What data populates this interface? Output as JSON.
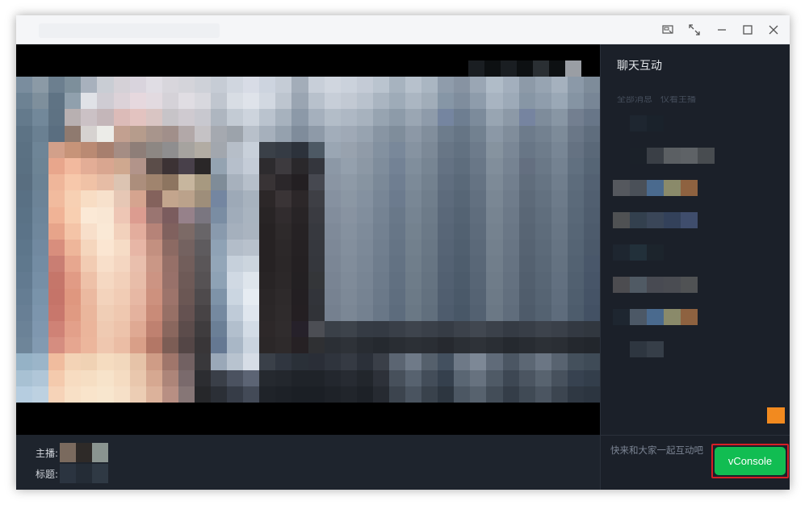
{
  "window": {
    "controls": [
      {
        "name": "pin-window-icon"
      },
      {
        "name": "expand-icon"
      },
      {
        "name": "minimize-icon"
      },
      {
        "name": "maximize-icon"
      },
      {
        "name": "close-icon"
      }
    ]
  },
  "video": {
    "description_state": "pixelated",
    "top_strip_colors": [
      "#1a1e22",
      "#0d1012",
      "#1a1e22",
      "#0d1012",
      "#2a2f33",
      "#0d1012",
      "#9a9ea4"
    ],
    "pixel_colors": [
      "#7a8d9e",
      "#8b9aa6",
      "#6c7f8f",
      "#7d8f9b",
      "#a8b1bd",
      "#c9cdd4",
      "#d5d1d7",
      "#d9d4dd",
      "#e0dde4",
      "#d8d6dc",
      "#d4d4da",
      "#ced1d8",
      "#c6ccd5",
      "#d0d6df",
      "#d8dce6",
      "#cdd4df",
      "#c5ccd6",
      "#a3adb9",
      "#c8cfd9",
      "#d0d6df",
      "#cbd2dc",
      "#c4cbd6",
      "#bac4cf",
      "#a7b3bf",
      "#b7c1cc",
      "#aab6c2",
      "#8f9cab",
      "#8793a2",
      "#9aa6b4",
      "#b0bcc8",
      "#a3afbd",
      "#8d9aa8",
      "#97a4b2",
      "#a5b1be",
      "#8b99a8",
      "#7e8c9a",
      "#6d8293",
      "#7e8f9c",
      "#5f7384",
      "#90a0ad",
      "#e0e2e7",
      "#cfccd3",
      "#dcd2d8",
      "#e6d8de",
      "#e2dae0",
      "#d5d2d8",
      "#e0dde3",
      "#d8d8de",
      "#c0c6cf",
      "#d8dde4",
      "#dfe3ea",
      "#d2d8e1",
      "#bdc5cf",
      "#9aa5b2",
      "#b8c1cc",
      "#c7ced8",
      "#c2c9d3",
      "#b9c2cd",
      "#aab5c1",
      "#9eabb8",
      "#abb6c2",
      "#a1adb9",
      "#8696a6",
      "#7f8d9d",
      "#8e9cab",
      "#a8b4c1",
      "#9daab8",
      "#8796a5",
      "#8f9dac",
      "#9aa8b6",
      "#8594a3",
      "#788696",
      "#647a8c",
      "#72889a",
      "#5e7283",
      "#b8b0b1",
      "#cbc1c5",
      "#c4b6b9",
      "#dcbbb8",
      "#e3c3c0",
      "#d9c5c3",
      "#c7c4c8",
      "#cfcad0",
      "#c8c8cf",
      "#aeb6c0",
      "#c3cbd4",
      "#cdd4dd",
      "#bac3ce",
      "#a7b2be",
      "#8c99a8",
      "#a5b0bd",
      "#b3bdc8",
      "#aeb8c4",
      "#a7b2be",
      "#97a4b1",
      "#8d9ba9",
      "#9aa6b3",
      "#8e9baa",
      "#7585a0",
      "#6e7e91",
      "#7c8b9b",
      "#98a5b2",
      "#8c99a7",
      "#7684a0",
      "#7e8c9b",
      "#8896a4",
      "#737f90",
      "#687688",
      "#5d7385",
      "#6a8092",
      "#5a6e80",
      "#8f7a6f",
      "#d6d2d0",
      "#ecece8",
      "#c2a090",
      "#b69c8c",
      "#a8958c",
      "#a18f8a",
      "#b2a8a8",
      "#c5c2c5",
      "#a5a9b0",
      "#9ca3ab",
      "#b8c0ca",
      "#a6b0bc",
      "#95a1ae",
      "#7f8c9b",
      "#8e9aa8",
      "#a2adba",
      "#9fa9b6",
      "#97a3b0",
      "#8895a3",
      "#7f8d9b",
      "#8c98a6",
      "#818e9c",
      "#6d7c8c",
      "#667585",
      "#728190",
      "#8b98a6",
      "#808d9b",
      "#6d7b8b",
      "#738190",
      "#7d8b99",
      "#6a7787",
      "#5f6d7d",
      "#5b7183",
      "#6e8597",
      "#d2a08a",
      "#c79479",
      "#ba8a73",
      "#a77f6e",
      "#a58d84",
      "#8e7e78",
      "#8d8783",
      "#8f8e8f",
      "#a6a39f",
      "#b2aca3",
      "#a2a7ae",
      "#b6bec8",
      "#c8d0da",
      "#3a4048",
      "#353b44",
      "#2c323b",
      "#4d5964",
      "#9aa6b3",
      "#98a2ae",
      "#909ba8",
      "#8391a0",
      "#79889a",
      "#8693a1",
      "#7c8997",
      "#687686",
      "#627181",
      "#6d7b8b",
      "#86939f",
      "#7a8796",
      "#687686",
      "#6e7c8b",
      "#788695",
      "#657282",
      "#5a6878",
      "#5a7082",
      "#6d8495",
      "#e8a68c",
      "#f2b99e",
      "#e3ad96",
      "#d9a690",
      "#cfa88f",
      "#b2948a",
      "#5b4d49",
      "#3c3234",
      "#48404a",
      "#2a2728",
      "#94a3b1",
      "#b6bfcb",
      "#c4ccd7",
      "#2d2b2e",
      "#3d3a3e",
      "#2a282b",
      "#34363d",
      "#8c98a6",
      "#94a0ad",
      "#8c98a5",
      "#7f8d9c",
      "#738295",
      "#808e9c",
      "#778593",
      "#647283",
      "#5e6d7d",
      "#697787",
      "#818e9b",
      "#768392",
      "#646f80",
      "#6a7887",
      "#748291",
      "#617080",
      "#566575",
      "#596e80",
      "#6b8294",
      "#efb69a",
      "#f7c8ab",
      "#f0c2a6",
      "#e6bca5",
      "#dcc4b2",
      "#ac8e7c",
      "#a0846e",
      "#8d7560",
      "#c7b69e",
      "#a79980",
      "#7f8c98",
      "#a7b1bd",
      "#b6bfca",
      "#383335",
      "#2b272a",
      "#231f22",
      "#464850",
      "#8a95a3",
      "#8e9aa7",
      "#8794a1",
      "#7b8998",
      "#6f7e91",
      "#7c8a98",
      "#73818f",
      "#606e7f",
      "#5a6979",
      "#657383",
      "#7d8a97",
      "#727f8e",
      "#606d7c",
      "#667483",
      "#707e8d",
      "#5d6c7c",
      "#536172",
      "#597084",
      "#6c8397",
      "#f1bb9e",
      "#f7d0b3",
      "#f8ddc4",
      "#f7e1cc",
      "#e6c7b5",
      "#d5a48f",
      "#84625c",
      "#c3a58d",
      "#bba28b",
      "#9e8e7a",
      "#7486a1",
      "#9da9b7",
      "#a7b2be",
      "#2c2728",
      "#3a3436",
      "#2c2729",
      "#3e3f45",
      "#8691a0",
      "#8b97a4",
      "#8491a0",
      "#788696",
      "#6c7b8e",
      "#798795",
      "#707e8c",
      "#5d6b7c",
      "#576676",
      "#627080",
      "#7a8794",
      "#6f7c8b",
      "#5d6a79",
      "#637180",
      "#6d7b8a",
      "#5b6a7a",
      "#515f70",
      "#5a7286",
      "#6d859a",
      "#f0b396",
      "#f8cfb1",
      "#fbe9d6",
      "#f9e7d4",
      "#eec6b5",
      "#dc9c90",
      "#9a7571",
      "#7b5c5e",
      "#96818a",
      "#7a7680",
      "#7a8da3",
      "#a0acba",
      "#a9b4c0",
      "#282425",
      "#312c2e",
      "#282426",
      "#3a3b41",
      "#828d9c",
      "#8893a1",
      "#818e9d",
      "#758393",
      "#697889",
      "#768492",
      "#6d7b89",
      "#5a6879",
      "#546373",
      "#5f6d7d",
      "#778491",
      "#6c7988",
      "#5a6776",
      "#606e7d",
      "#6a7887",
      "#596878",
      "#4f5d6e",
      "#5b7388",
      "#6f879c",
      "#e7a48a",
      "#f4c4a7",
      "#f8dfca",
      "#fae9d6",
      "#f2d1bc",
      "#e3ad9d",
      "#b68378",
      "#80615e",
      "#7c6a66",
      "#686568",
      "#899aad",
      "#a5b0bd",
      "#aab4c0",
      "#262223",
      "#2e2a2b",
      "#262224",
      "#37393f",
      "#7f8a99",
      "#85919f",
      "#7e8b9a",
      "#738191",
      "#677687",
      "#74828f",
      "#6b7987",
      "#586677",
      "#526171",
      "#5d6b7b",
      "#75828f",
      "#6a7786",
      "#586574",
      "#5e6c7b",
      "#687685",
      "#576676",
      "#4d5b6c",
      "#5d768b",
      "#7189a0",
      "#d88e7d",
      "#eeb69a",
      "#f5d6bd",
      "#fbe6d2",
      "#f6dcc6",
      "#e7b6a6",
      "#c39080",
      "#8c6a63",
      "#746260",
      "#5e5b5e",
      "#8fa2b5",
      "#b3bdc9",
      "#b8c1cc",
      "#262223",
      "#2c2829",
      "#252123",
      "#36383e",
      "#7d8897",
      "#838f9d",
      "#7c8998",
      "#717f8f",
      "#657485",
      "#72808d",
      "#697785",
      "#566475",
      "#505f6f",
      "#5b6979",
      "#73808d",
      "#687584",
      "#566372",
      "#5c6a79",
      "#667483",
      "#556474",
      "#4b596a",
      "#5f788d",
      "#738ca3",
      "#c97e73",
      "#e7a78f",
      "#f2ccb3",
      "#f8dfca",
      "#f4d6c1",
      "#e9bfad",
      "#ca9786",
      "#967068",
      "#725e5b",
      "#5a5658",
      "#93a6b8",
      "#c6d0db",
      "#ccd5de",
      "#262223",
      "#2b2728",
      "#242022",
      "#35373d",
      "#7b8695",
      "#818d9b",
      "#7a8796",
      "#6f7d8d",
      "#637283",
      "#707e8b",
      "#677583",
      "#546273",
      "#4e5d6d",
      "#596777",
      "#717e8b",
      "#667382",
      "#546170",
      "#5a6877",
      "#647281",
      "#536272",
      "#49576a",
      "#627a90",
      "#768fa6",
      "#c5766a",
      "#e19b85",
      "#eec1a8",
      "#f5d8c2",
      "#f2d0ba",
      "#e8bda9",
      "#cc9483",
      "#98716a",
      "#6e5a57",
      "#565254",
      "#8ea2b5",
      "#d0d9e3",
      "#dee5ec",
      "#282425",
      "#2c2829",
      "#232022",
      "#343639",
      "#798493",
      "#7f8b99",
      "#788594",
      "#6d7b8b",
      "#617081",
      "#6e7c89",
      "#657381",
      "#526071",
      "#4c5b6b",
      "#576575",
      "#6f7c89",
      "#647180",
      "#525f6e",
      "#586675",
      "#627080",
      "#516070",
      "#475568",
      "#657d93",
      "#7993aa",
      "#c57469",
      "#df977f",
      "#ebb9a0",
      "#f3d3bc",
      "#f1ccb5",
      "#e7b8a4",
      "#cd917e",
      "#9d746b",
      "#6b5754",
      "#4e4a4c",
      "#7e93a8",
      "#cbd6e1",
      "#e6ecf2",
      "#2a2627",
      "#2e2a2b",
      "#231f22",
      "#32343a",
      "#778291",
      "#7d8997",
      "#768392",
      "#6b7989",
      "#5f6e7f",
      "#6c7a87",
      "#63717f",
      "#505e6f",
      "#4a5969",
      "#556373",
      "#6d7a87",
      "#626f7e",
      "#505d6c",
      "#566473",
      "#606e7e",
      "#4f5e6e",
      "#455366",
      "#687f95",
      "#7c95ad",
      "#c8776c",
      "#e09a82",
      "#eab69c",
      "#f0ceb6",
      "#efc8b0",
      "#e4b29e",
      "#c98b78",
      "#977066",
      "#655251",
      "#474345",
      "#7589a0",
      "#bfcbd8",
      "#dfe6ee",
      "#2b2728",
      "#2f2b2c",
      "#241f22",
      "#313338",
      "#75808f",
      "#7b8795",
      "#748190",
      "#697787",
      "#5d6c7d",
      "#6a7885",
      "#616f7d",
      "#4e5c6d",
      "#485767",
      "#536171",
      "#6b7885",
      "#606d7c",
      "#4e5b6a",
      "#546271",
      "#5e6c7c",
      "#4d5c6c",
      "#435164",
      "#6b8297",
      "#7f97af",
      "#cf8276",
      "#e3a08a",
      "#ebb59b",
      "#efcab2",
      "#edc3ab",
      "#dfa993",
      "#bf8170",
      "#8a675e",
      "#5c4c4b",
      "#3f3c3e",
      "#6b7f96",
      "#b2bfcd",
      "#d3dce6",
      "#2d2829",
      "#302c2d",
      "#26212a",
      "#4c4e54",
      "#3a4048",
      "#3d434b",
      "#353b44",
      "#343a43",
      "#393f48",
      "#3e444d",
      "#3a4049",
      "#363c45",
      "#3c424b",
      "#414750",
      "#3b414a",
      "#353b44",
      "#383e47",
      "#3d434c",
      "#3a4049",
      "#333942",
      "#31373f",
      "#6e8599",
      "#829ab1",
      "#d58d80",
      "#e6a690",
      "#ecb69c",
      "#efc7af",
      "#ebbda5",
      "#d99f88",
      "#b37766",
      "#7c5d55",
      "#544646",
      "#393638",
      "#657892",
      "#a9b7c6",
      "#cad4df",
      "#2b2728",
      "#2e2a2b",
      "#262124",
      "#2f3033",
      "#2b2f35",
      "#2e3238",
      "#282c32",
      "#25292f",
      "#292d33",
      "#2c3036",
      "#2a2e34",
      "#26292f",
      "#2b2f35",
      "#2e3238",
      "#2a2e34",
      "#25292f",
      "#282c32",
      "#2c3036",
      "#2a2e34",
      "#24282e",
      "#22262c",
      "#95b2c6",
      "#9bb5c9",
      "#f0bc9e",
      "#f3d3b6",
      "#f0d2b4",
      "#f5dcc0",
      "#f2d8bd",
      "#e6c3a8",
      "#cf9c86",
      "#a0766b",
      "#726162",
      "#39383b",
      "#9aa8b8",
      "#b8c3cf",
      "#d6dde6",
      "#3a4049",
      "#303640",
      "#2a3038",
      "#2a2e37",
      "#2f343d",
      "#353a43",
      "#2b3039",
      "#3a3f48",
      "#5b6572",
      "#6f7a88",
      "#55606c",
      "#43505f",
      "#6e7987",
      "#7d8896",
      "#606b79",
      "#4b5663",
      "#5c6774",
      "#6b7684",
      "#586370",
      "#44505c",
      "#3f4b57",
      "#a8c1d3",
      "#b0c6d8",
      "#f4caad",
      "#f7dcc1",
      "#f6dec3",
      "#f7e3ca",
      "#f5dcc2",
      "#e9c7ad",
      "#d6a891",
      "#ad8579",
      "#7a6a6c",
      "#2c2d31",
      "#3a3f48",
      "#4b5260",
      "#5c6474",
      "#25292f",
      "#23272d",
      "#1f2329",
      "#1f2329",
      "#23272e",
      "#272b32",
      "#22262c",
      "#2d3139",
      "#47505b",
      "#57626f",
      "#434d59",
      "#35404d",
      "#5a6673",
      "#67727f",
      "#4f5a66",
      "#3d4753",
      "#4b5561",
      "#58636f",
      "#47515d",
      "#374250",
      "#333e4b",
      "#b6cde0",
      "#bdd1e1",
      "#f6d3b8",
      "#f8e0c6",
      "#f9e4cb",
      "#f8e6ce",
      "#f6e0c8",
      "#eccdb4",
      "#dcb29b",
      "#b88f83",
      "#867676",
      "#26272a",
      "#2b2f36",
      "#363c47",
      "#434a57",
      "#1f2329",
      "#1d2127",
      "#1b1f25",
      "#1b1f25",
      "#1e2228",
      "#21252b",
      "#1d2127",
      "#262a31",
      "#3c444e",
      "#4a5460",
      "#39424c",
      "#2d3640",
      "#4c5763",
      "#57626e",
      "#434d58",
      "#343d48",
      "#404a55",
      "#4b5561",
      "#3c4550",
      "#2f3843",
      "#2c3540"
    ]
  },
  "info": {
    "anchor_label": "主播:",
    "title_label": "标题:",
    "anchor_colors": [
      "#7a6a5e",
      "#2e2a28",
      "#8a9490"
    ],
    "title_colors": [
      "#2b3440",
      "#242c36",
      "#2f3944"
    ]
  },
  "chat": {
    "title": "聊天互动",
    "tabs": [
      "全部消息",
      "仅看主播"
    ],
    "messages": [
      {
        "colors": [
          "#1e2630",
          "#1a222b"
        ]
      },
      {
        "colors": [
          "#1b2129",
          "#3a3f46",
          "#5b5f63",
          "#5e6266",
          "#484c50"
        ]
      },
      {
        "colors": [
          "#55585e",
          "#4a5058",
          "#4a6a8e",
          "#8a8a6a",
          "#8e6240"
        ]
      },
      {
        "colors": [
          "#4f5153",
          "#33404e",
          "#3a4658",
          "#33415a",
          "#3f4d6c"
        ]
      },
      {
        "colors": [
          "#1e2630",
          "#22303a",
          "#1c242c"
        ]
      },
      {
        "colors": [
          "#4c4c50",
          "#505a64",
          "#484a52",
          "#4a4c52",
          "#505254"
        ]
      },
      {
        "colors": [
          "#1e2630",
          "#4c5866",
          "#4a6a8e",
          "#8a8a6a",
          "#8e6240"
        ]
      },
      {
        "colors": [
          "#2e3640",
          "#363e48"
        ]
      }
    ],
    "input_placeholder": "快来和大家一起互动吧",
    "vconsole_label": "vConsole"
  }
}
